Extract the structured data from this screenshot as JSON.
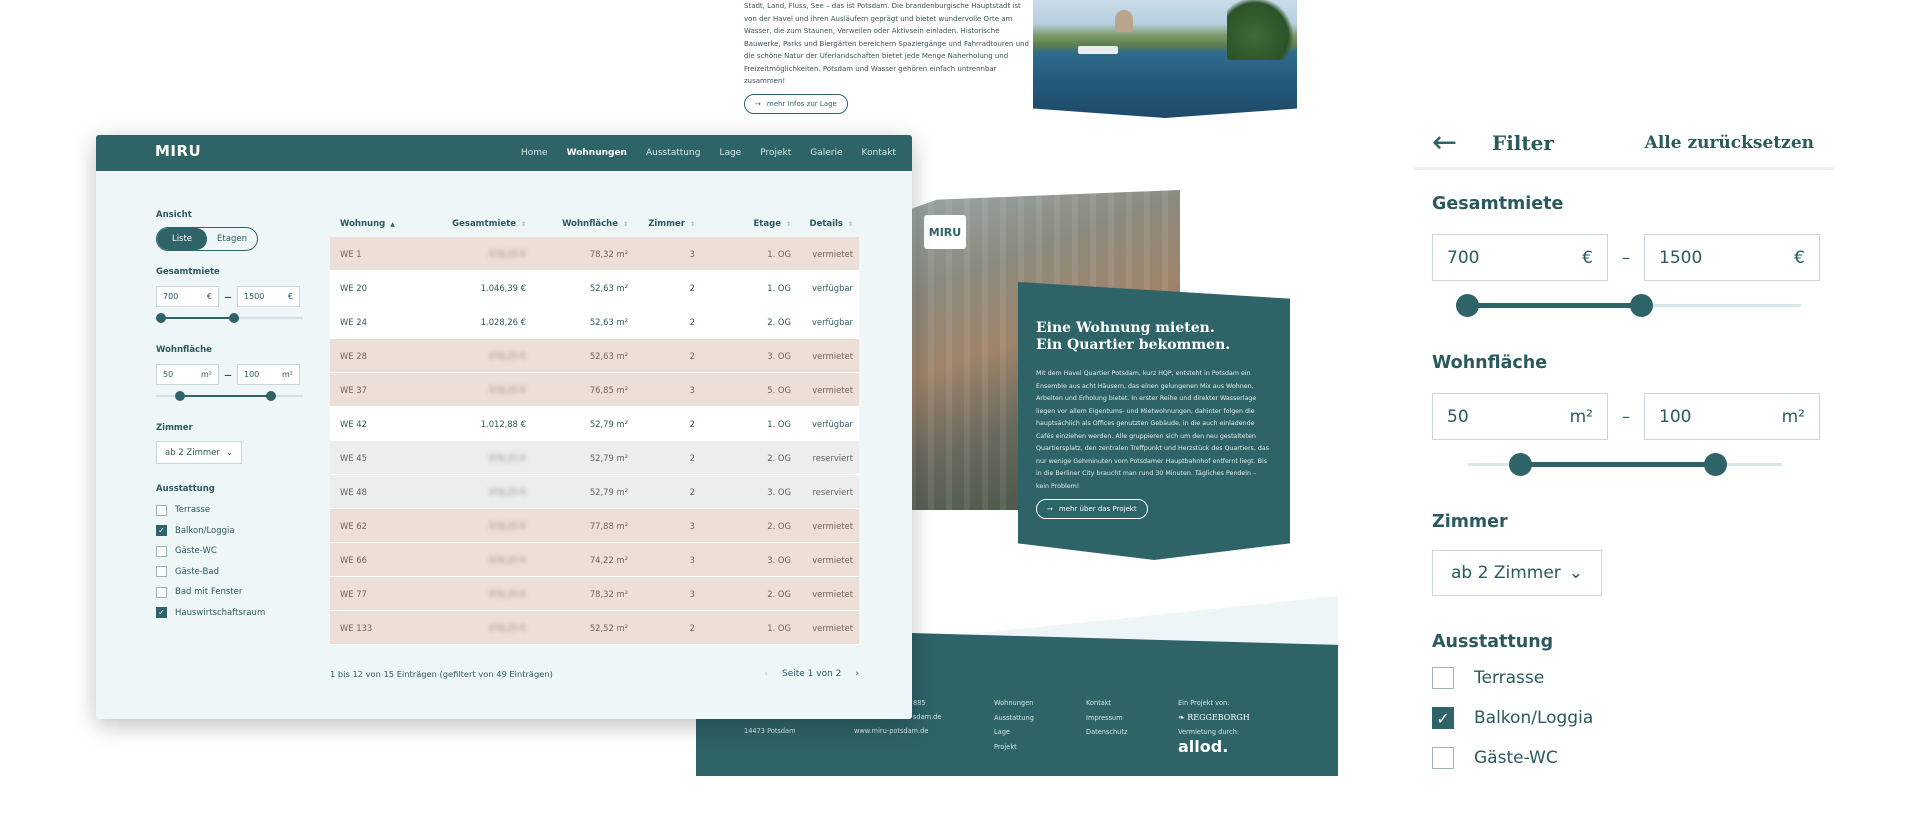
{
  "background": {
    "intro_lines": [
      "Stadt, Land, Fluss, See – das ist Potsdam. Die brandenburgische Hauptstadt ist",
      "von der Havel und ihren Ausläufern geprägt und bietet wundervolle Orte am",
      "Wasser, die zum Staunen, Verweilen oder Aktivsein einladen. Historische",
      "Bauwerke, Parks und Biergärten bereichern Spaziergänge und Fahrradtouren und",
      "die schöne Natur der Uferlandschaften bietet jede Menge Naherholung und",
      "Freizeitmöglichkeiten. Potsdam und Wasser gehören einfach untrennbar",
      "zusammen!"
    ],
    "lage_button": "mehr Infos zur Lage",
    "photo_badge": "MIRU",
    "quarter_title_1": "Eine Wohnung mieten.",
    "quarter_title_2": "Ein Quartier bekommen.",
    "quarter_text": [
      "Mit dem Havel Quartier Potsdam, kurz HQP, entsteht in Potsdam ein",
      "Ensemble aus acht Häusern, das einen gelungenen Mix aus Wohnen,",
      "Arbeiten und Erholung bietet. In erster Reihe und direkter Wasserlage",
      "liegen vor allem Eigentums- und Mietwohnungen, dahinter folgen die",
      "hauptsächlich als Offices genutzten Gebäude, in die auch einladende",
      "Cafés einziehen werden. Alle gruppieren sich um den neu gestalteten",
      "Quartiersplatz, den zentralen Treffpunkt und Herzstück des Quartiers, das",
      "nur wenige Gehminuten vom Potsdamer Hauptbahnhof entfernt liegt. Bis",
      "in die Berliner City braucht man rund 30 Minuten. Tägliches Pendeln –",
      "kein Problem!"
    ],
    "projekt_button": "mehr über das Projekt",
    "footer": {
      "address_1": "885",
      "address_2": "sdam.de",
      "address_city": "14473 Potsdam",
      "website": "www.miru-potsdam.de",
      "nav_col1": [
        "Wohnungen",
        "Ausstattung",
        "Lage",
        "Projekt"
      ],
      "nav_col2": [
        "Kontakt",
        "Impressum",
        "Datenschutz"
      ],
      "project_by": "Ein Projekt von:",
      "developer": "REGGEBORGH",
      "letting_by": "Vermietung durch:",
      "agent": "allod."
    }
  },
  "app": {
    "logo": "MIRU",
    "nav": [
      {
        "label": "Home",
        "active": false
      },
      {
        "label": "Wohnungen",
        "active": true
      },
      {
        "label": "Ausstattung",
        "active": false
      },
      {
        "label": "Lage",
        "active": false
      },
      {
        "label": "Projekt",
        "active": false
      },
      {
        "label": "Galerie",
        "active": false
      },
      {
        "label": "Kontakt",
        "active": false
      }
    ],
    "sidebar": {
      "view_label": "Ansicht",
      "view_list": "Liste",
      "view_floors": "Etagen",
      "rent_label": "Gesamtmiete",
      "rent_min": "700",
      "rent_max": "1500",
      "rent_unit": "€",
      "rent_range_fraction": [
        0.0,
        0.53
      ],
      "area_label": "Wohnfläche",
      "area_min": "50",
      "area_max": "100",
      "area_unit": "m²",
      "area_range_fraction": [
        0.14,
        0.8
      ],
      "rooms_label": "Zimmer",
      "rooms_value": "ab 2 Zimmer",
      "features_label": "Ausstattung",
      "features": [
        {
          "label": "Terrasse",
          "checked": false
        },
        {
          "label": "Balkon/Loggia",
          "checked": true
        },
        {
          "label": "Gäste-WC",
          "checked": false
        },
        {
          "label": "Gäste-Bad",
          "checked": false
        },
        {
          "label": "Bad mit Fenster",
          "checked": false
        },
        {
          "label": "Hauswirtschaftsraum",
          "checked": true
        }
      ]
    },
    "table": {
      "headers": [
        "Wohnung",
        "Gesamtmiete",
        "Wohnfläche",
        "Zimmer",
        "Etage",
        "Details"
      ],
      "rows": [
        {
          "unit": "WE 1",
          "rent": "978,25 €",
          "area": "78,32 m²",
          "rooms": "3",
          "floor": "1. OG",
          "status": "vermietet"
        },
        {
          "unit": "WE 20",
          "rent": "1.046,39 €",
          "area": "52,63 m²",
          "rooms": "2",
          "floor": "1. OG",
          "status": "verfügbar"
        },
        {
          "unit": "WE 24",
          "rent": "1.028,26 €",
          "area": "52,63 m²",
          "rooms": "2",
          "floor": "2. OG",
          "status": "verfügbar"
        },
        {
          "unit": "WE 28",
          "rent": "978,25 €",
          "area": "52,63 m²",
          "rooms": "2",
          "floor": "3. OG",
          "status": "vermietet"
        },
        {
          "unit": "WE 37",
          "rent": "978,25 €",
          "area": "76,85 m²",
          "rooms": "3",
          "floor": "5. OG",
          "status": "vermietet"
        },
        {
          "unit": "WE 42",
          "rent": "1.012,88 €",
          "area": "52,79 m²",
          "rooms": "2",
          "floor": "1. OG",
          "status": "verfügbar"
        },
        {
          "unit": "WE 45",
          "rent": "978,25 €",
          "area": "52,79 m²",
          "rooms": "2",
          "floor": "2. OG",
          "status": "reserviert"
        },
        {
          "unit": "WE 48",
          "rent": "978,25 €",
          "area": "52,79 m²",
          "rooms": "2",
          "floor": "3. OG",
          "status": "reserviert"
        },
        {
          "unit": "WE 62",
          "rent": "978,25 €",
          "area": "77,88 m²",
          "rooms": "3",
          "floor": "2. OG",
          "status": "vermietet"
        },
        {
          "unit": "WE 66",
          "rent": "978,25 €",
          "area": "74,22 m²",
          "rooms": "3",
          "floor": "3. OG",
          "status": "vermietet"
        },
        {
          "unit": "WE 77",
          "rent": "978,25 €",
          "area": "78,32 m²",
          "rooms": "3",
          "floor": "2. OG",
          "status": "vermietet"
        },
        {
          "unit": "WE 133",
          "rent": "978,25 €",
          "area": "52,52 m²",
          "rooms": "2",
          "floor": "1. OG",
          "status": "vermietet"
        }
      ],
      "summary": "1 bis 12 von 15 Einträgen (gefiltert von 49 Einträgen)",
      "page_label": "Seite 1 von 2"
    }
  },
  "filter_panel": {
    "title": "Filter",
    "reset": "Alle zurücksetzen",
    "rent_label": "Gesamtmiete",
    "rent_min": "700",
    "rent_max": "1500",
    "rent_unit": "€",
    "rent_range_fraction": [
      0.0,
      0.54
    ],
    "area_label": "Wohnfläche",
    "area_min": "50",
    "area_max": "100",
    "area_unit": "m²",
    "area_range_fraction": [
      0.14,
      0.81
    ],
    "rooms_label": "Zimmer",
    "rooms_value": "ab 2 Zimmer",
    "features_label": "Ausstattung",
    "features": [
      {
        "label": "Terrasse",
        "checked": false
      },
      {
        "label": "Balkon/Loggia",
        "checked": true
      },
      {
        "label": "Gäste-WC",
        "checked": false
      }
    ]
  },
  "colors": {
    "brand": "#2e6367",
    "rented_row": "#ecdfd7",
    "reserved_row": "#eceded",
    "available_row": "#ffffff"
  }
}
